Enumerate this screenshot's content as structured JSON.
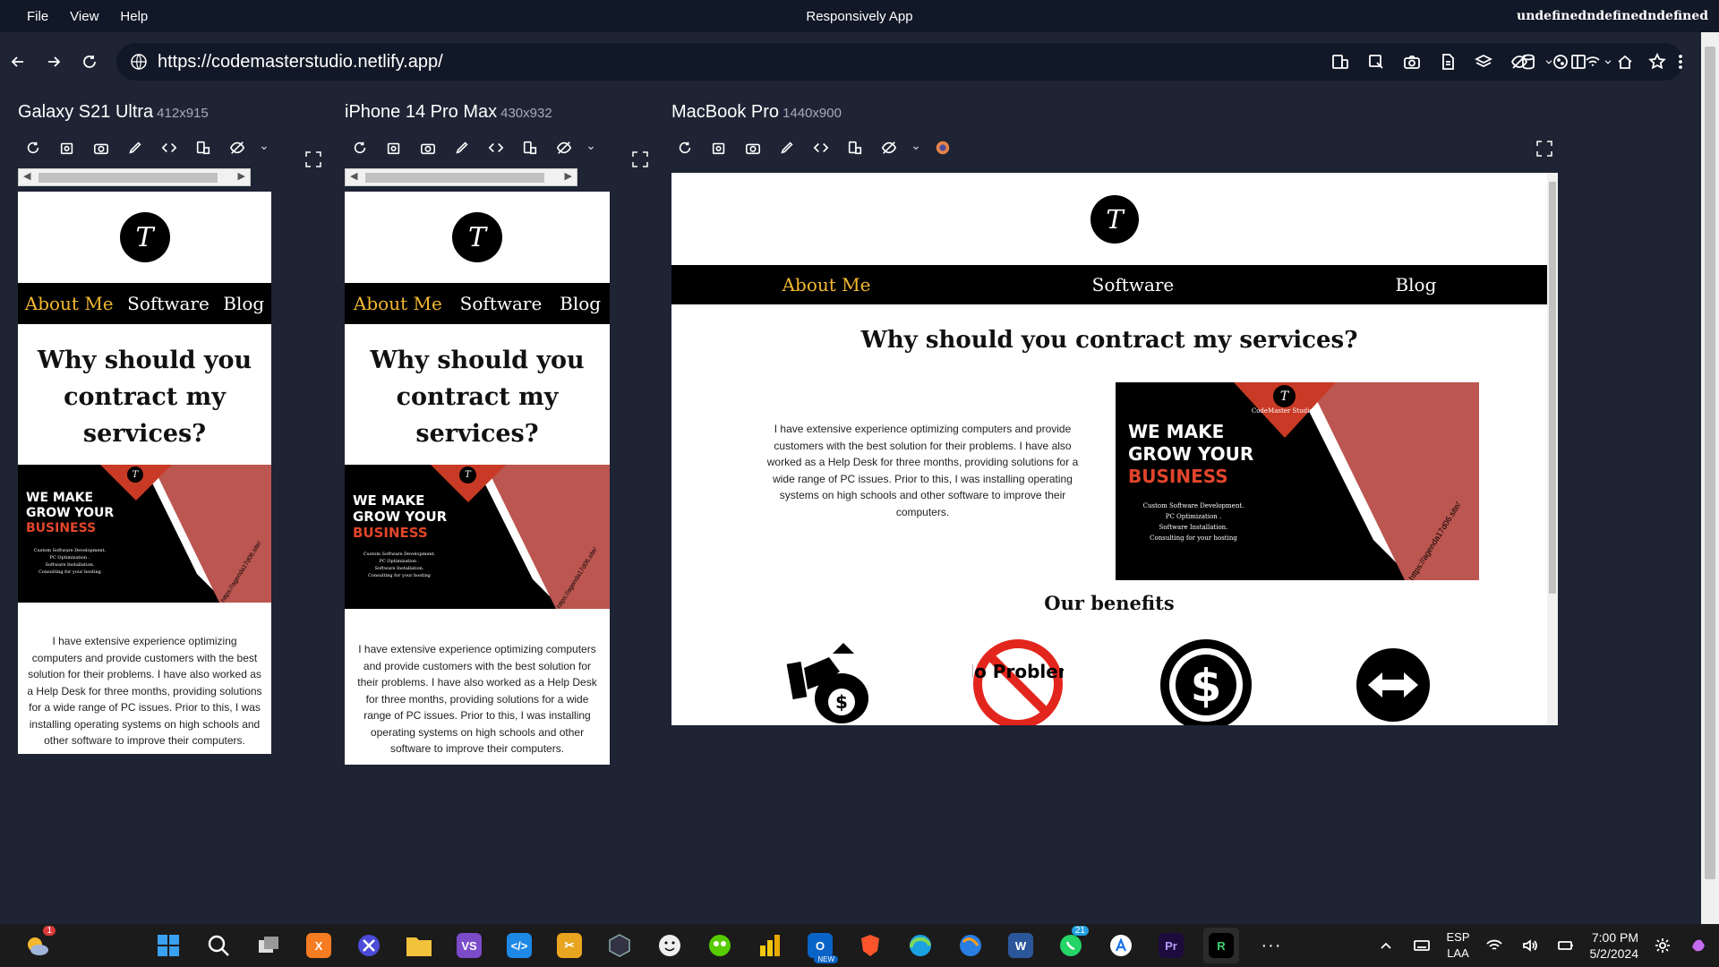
{
  "window": {
    "menu": [
      "File",
      "View",
      "Help"
    ],
    "title": "Responsively App",
    "user": "undefinedndefinedndefined"
  },
  "address_bar": {
    "url": "https://codemasterstudio.netlify.app/"
  },
  "devices": [
    {
      "name": "Galaxy S21 Ultra",
      "dims": "412x915"
    },
    {
      "name": "iPhone 14 Pro Max",
      "dims": "430x932"
    },
    {
      "name": "MacBook Pro",
      "dims": "1440x900"
    }
  ],
  "site": {
    "logo_letter": "T",
    "nav": [
      "About Me",
      "Software",
      "Blog"
    ],
    "active_nav": "About Me",
    "heading": "Why should you contract my services?",
    "paragraph": "I have extensive experience optimizing computers and provide customers with the best solution for their problems. I have also worked as a Help Desk for three months, providing solutions for a wide range of PC issues. Prior to this, I was installing operating systems on high schools and other software to improve their computers.",
    "banner": {
      "line1": "WE MAKE",
      "line2": "GROW YOUR",
      "line3": "BUSINESS",
      "brand": "CodeMaster Studios",
      "services": [
        "Custom Software Development.",
        "PC Optimization .",
        "Software Installation.",
        "Consulting for your hosting"
      ],
      "url": "https://agenda17d06.site/"
    },
    "benefits_title": "Our benefits",
    "benefit_icons": [
      "money-bag-icon",
      "no-problem-icon",
      "dollar-circle-icon",
      "arrows-horizontal-icon"
    ],
    "no_problem_text": "No Problem"
  },
  "taskbar": {
    "lang": "ESP",
    "layout": "LAA",
    "time": "7:00 PM",
    "date": "5/2/2024",
    "whatsapp_badge": "21",
    "notif_badge": "1",
    "outlook_badge": "NEW"
  },
  "colors": {
    "background": "#1e2434",
    "accent_nav": "#f3b830",
    "banner_red": "#bb5650",
    "business_red": "#e2452b"
  }
}
